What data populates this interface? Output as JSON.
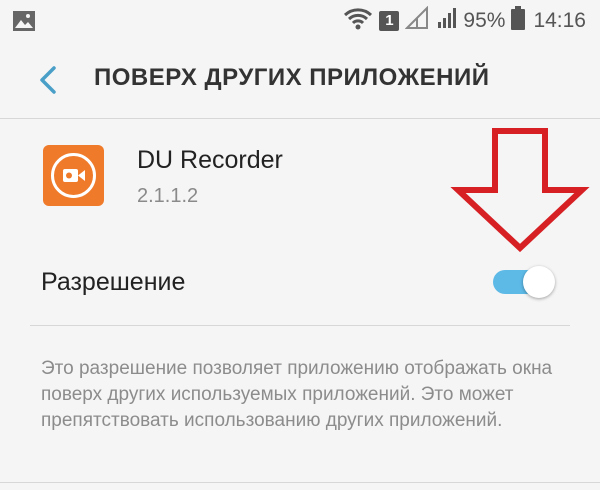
{
  "status_bar": {
    "notification_icon": "image-icon",
    "wifi_icon": "wifi-icon",
    "sim_badge": "1",
    "signal_icon": "signal-icon",
    "battery_percent": "95%",
    "battery_icon": "battery-icon",
    "time": "14:16"
  },
  "header": {
    "back_icon": "back-chevron-icon",
    "title": "ПОВЕРХ ДРУГИХ ПРИЛОЖЕНИЙ"
  },
  "app": {
    "name": "DU Recorder",
    "version": "2.1.1.2",
    "icon": "du-recorder-icon"
  },
  "permission": {
    "label": "Разрешение",
    "enabled": true
  },
  "description": "Это разрешение позволяет приложению отображать окна поверх других используемых приложений. Это может препятствовать использованию других приложений.",
  "annotation": {
    "arrow_icon": "red-down-arrow-icon"
  },
  "colors": {
    "background": "#f5f5f5",
    "accent_back": "#4a9fc8",
    "toggle_on": "#5db9e6",
    "app_icon": "#ef7a2a",
    "arrow": "#d62024"
  }
}
